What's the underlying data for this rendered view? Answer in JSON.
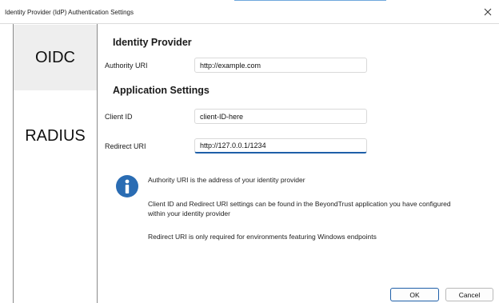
{
  "window": {
    "title": "Identity Provider (IdP) Authentication Settings"
  },
  "nav": {
    "items": [
      {
        "label": "OIDC",
        "selected": true
      },
      {
        "label": "RADIUS",
        "selected": false
      }
    ]
  },
  "identity_provider": {
    "heading": "Identity Provider",
    "authority_label": "Authority URI",
    "authority_value": "http://example.com"
  },
  "application_settings": {
    "heading": "Application Settings",
    "client_id_label": "Client ID",
    "client_id_value": "client-ID-here",
    "redirect_label": "Redirect URI",
    "redirect_value": "http://127.0.0.1/1234"
  },
  "info": {
    "icon": "info-icon",
    "lines": [
      "Authority URI is the address of your identity provider",
      "Client ID and Redirect URI settings can be found in the BeyondTrust application you have configured within your identity provider",
      "Redirect URI is only required for environments featuring Windows endpoints"
    ]
  },
  "buttons": {
    "ok": "OK",
    "cancel": "Cancel"
  },
  "colors": {
    "accent": "#1e5fa8",
    "info_icon": "#2a6cb3",
    "nav_selected_bg": "#eeeeee"
  }
}
